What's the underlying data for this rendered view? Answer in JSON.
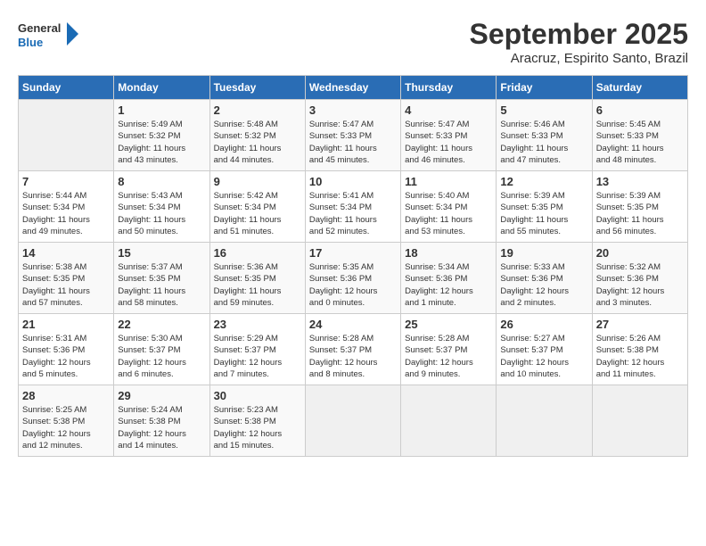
{
  "header": {
    "logo_line1": "General",
    "logo_line2": "Blue",
    "month": "September 2025",
    "location": "Aracruz, Espirito Santo, Brazil"
  },
  "days_of_week": [
    "Sunday",
    "Monday",
    "Tuesday",
    "Wednesday",
    "Thursday",
    "Friday",
    "Saturday"
  ],
  "weeks": [
    [
      {
        "num": "",
        "info": ""
      },
      {
        "num": "1",
        "info": "Sunrise: 5:49 AM\nSunset: 5:32 PM\nDaylight: 11 hours\nand 43 minutes."
      },
      {
        "num": "2",
        "info": "Sunrise: 5:48 AM\nSunset: 5:32 PM\nDaylight: 11 hours\nand 44 minutes."
      },
      {
        "num": "3",
        "info": "Sunrise: 5:47 AM\nSunset: 5:33 PM\nDaylight: 11 hours\nand 45 minutes."
      },
      {
        "num": "4",
        "info": "Sunrise: 5:47 AM\nSunset: 5:33 PM\nDaylight: 11 hours\nand 46 minutes."
      },
      {
        "num": "5",
        "info": "Sunrise: 5:46 AM\nSunset: 5:33 PM\nDaylight: 11 hours\nand 47 minutes."
      },
      {
        "num": "6",
        "info": "Sunrise: 5:45 AM\nSunset: 5:33 PM\nDaylight: 11 hours\nand 48 minutes."
      }
    ],
    [
      {
        "num": "7",
        "info": "Sunrise: 5:44 AM\nSunset: 5:34 PM\nDaylight: 11 hours\nand 49 minutes."
      },
      {
        "num": "8",
        "info": "Sunrise: 5:43 AM\nSunset: 5:34 PM\nDaylight: 11 hours\nand 50 minutes."
      },
      {
        "num": "9",
        "info": "Sunrise: 5:42 AM\nSunset: 5:34 PM\nDaylight: 11 hours\nand 51 minutes."
      },
      {
        "num": "10",
        "info": "Sunrise: 5:41 AM\nSunset: 5:34 PM\nDaylight: 11 hours\nand 52 minutes."
      },
      {
        "num": "11",
        "info": "Sunrise: 5:40 AM\nSunset: 5:34 PM\nDaylight: 11 hours\nand 53 minutes."
      },
      {
        "num": "12",
        "info": "Sunrise: 5:39 AM\nSunset: 5:35 PM\nDaylight: 11 hours\nand 55 minutes."
      },
      {
        "num": "13",
        "info": "Sunrise: 5:39 AM\nSunset: 5:35 PM\nDaylight: 11 hours\nand 56 minutes."
      }
    ],
    [
      {
        "num": "14",
        "info": "Sunrise: 5:38 AM\nSunset: 5:35 PM\nDaylight: 11 hours\nand 57 minutes."
      },
      {
        "num": "15",
        "info": "Sunrise: 5:37 AM\nSunset: 5:35 PM\nDaylight: 11 hours\nand 58 minutes."
      },
      {
        "num": "16",
        "info": "Sunrise: 5:36 AM\nSunset: 5:35 PM\nDaylight: 11 hours\nand 59 minutes."
      },
      {
        "num": "17",
        "info": "Sunrise: 5:35 AM\nSunset: 5:36 PM\nDaylight: 12 hours\nand 0 minutes."
      },
      {
        "num": "18",
        "info": "Sunrise: 5:34 AM\nSunset: 5:36 PM\nDaylight: 12 hours\nand 1 minute."
      },
      {
        "num": "19",
        "info": "Sunrise: 5:33 AM\nSunset: 5:36 PM\nDaylight: 12 hours\nand 2 minutes."
      },
      {
        "num": "20",
        "info": "Sunrise: 5:32 AM\nSunset: 5:36 PM\nDaylight: 12 hours\nand 3 minutes."
      }
    ],
    [
      {
        "num": "21",
        "info": "Sunrise: 5:31 AM\nSunset: 5:36 PM\nDaylight: 12 hours\nand 5 minutes."
      },
      {
        "num": "22",
        "info": "Sunrise: 5:30 AM\nSunset: 5:37 PM\nDaylight: 12 hours\nand 6 minutes."
      },
      {
        "num": "23",
        "info": "Sunrise: 5:29 AM\nSunset: 5:37 PM\nDaylight: 12 hours\nand 7 minutes."
      },
      {
        "num": "24",
        "info": "Sunrise: 5:28 AM\nSunset: 5:37 PM\nDaylight: 12 hours\nand 8 minutes."
      },
      {
        "num": "25",
        "info": "Sunrise: 5:28 AM\nSunset: 5:37 PM\nDaylight: 12 hours\nand 9 minutes."
      },
      {
        "num": "26",
        "info": "Sunrise: 5:27 AM\nSunset: 5:37 PM\nDaylight: 12 hours\nand 10 minutes."
      },
      {
        "num": "27",
        "info": "Sunrise: 5:26 AM\nSunset: 5:38 PM\nDaylight: 12 hours\nand 11 minutes."
      }
    ],
    [
      {
        "num": "28",
        "info": "Sunrise: 5:25 AM\nSunset: 5:38 PM\nDaylight: 12 hours\nand 12 minutes."
      },
      {
        "num": "29",
        "info": "Sunrise: 5:24 AM\nSunset: 5:38 PM\nDaylight: 12 hours\nand 14 minutes."
      },
      {
        "num": "30",
        "info": "Sunrise: 5:23 AM\nSunset: 5:38 PM\nDaylight: 12 hours\nand 15 minutes."
      },
      {
        "num": "",
        "info": ""
      },
      {
        "num": "",
        "info": ""
      },
      {
        "num": "",
        "info": ""
      },
      {
        "num": "",
        "info": ""
      }
    ]
  ]
}
